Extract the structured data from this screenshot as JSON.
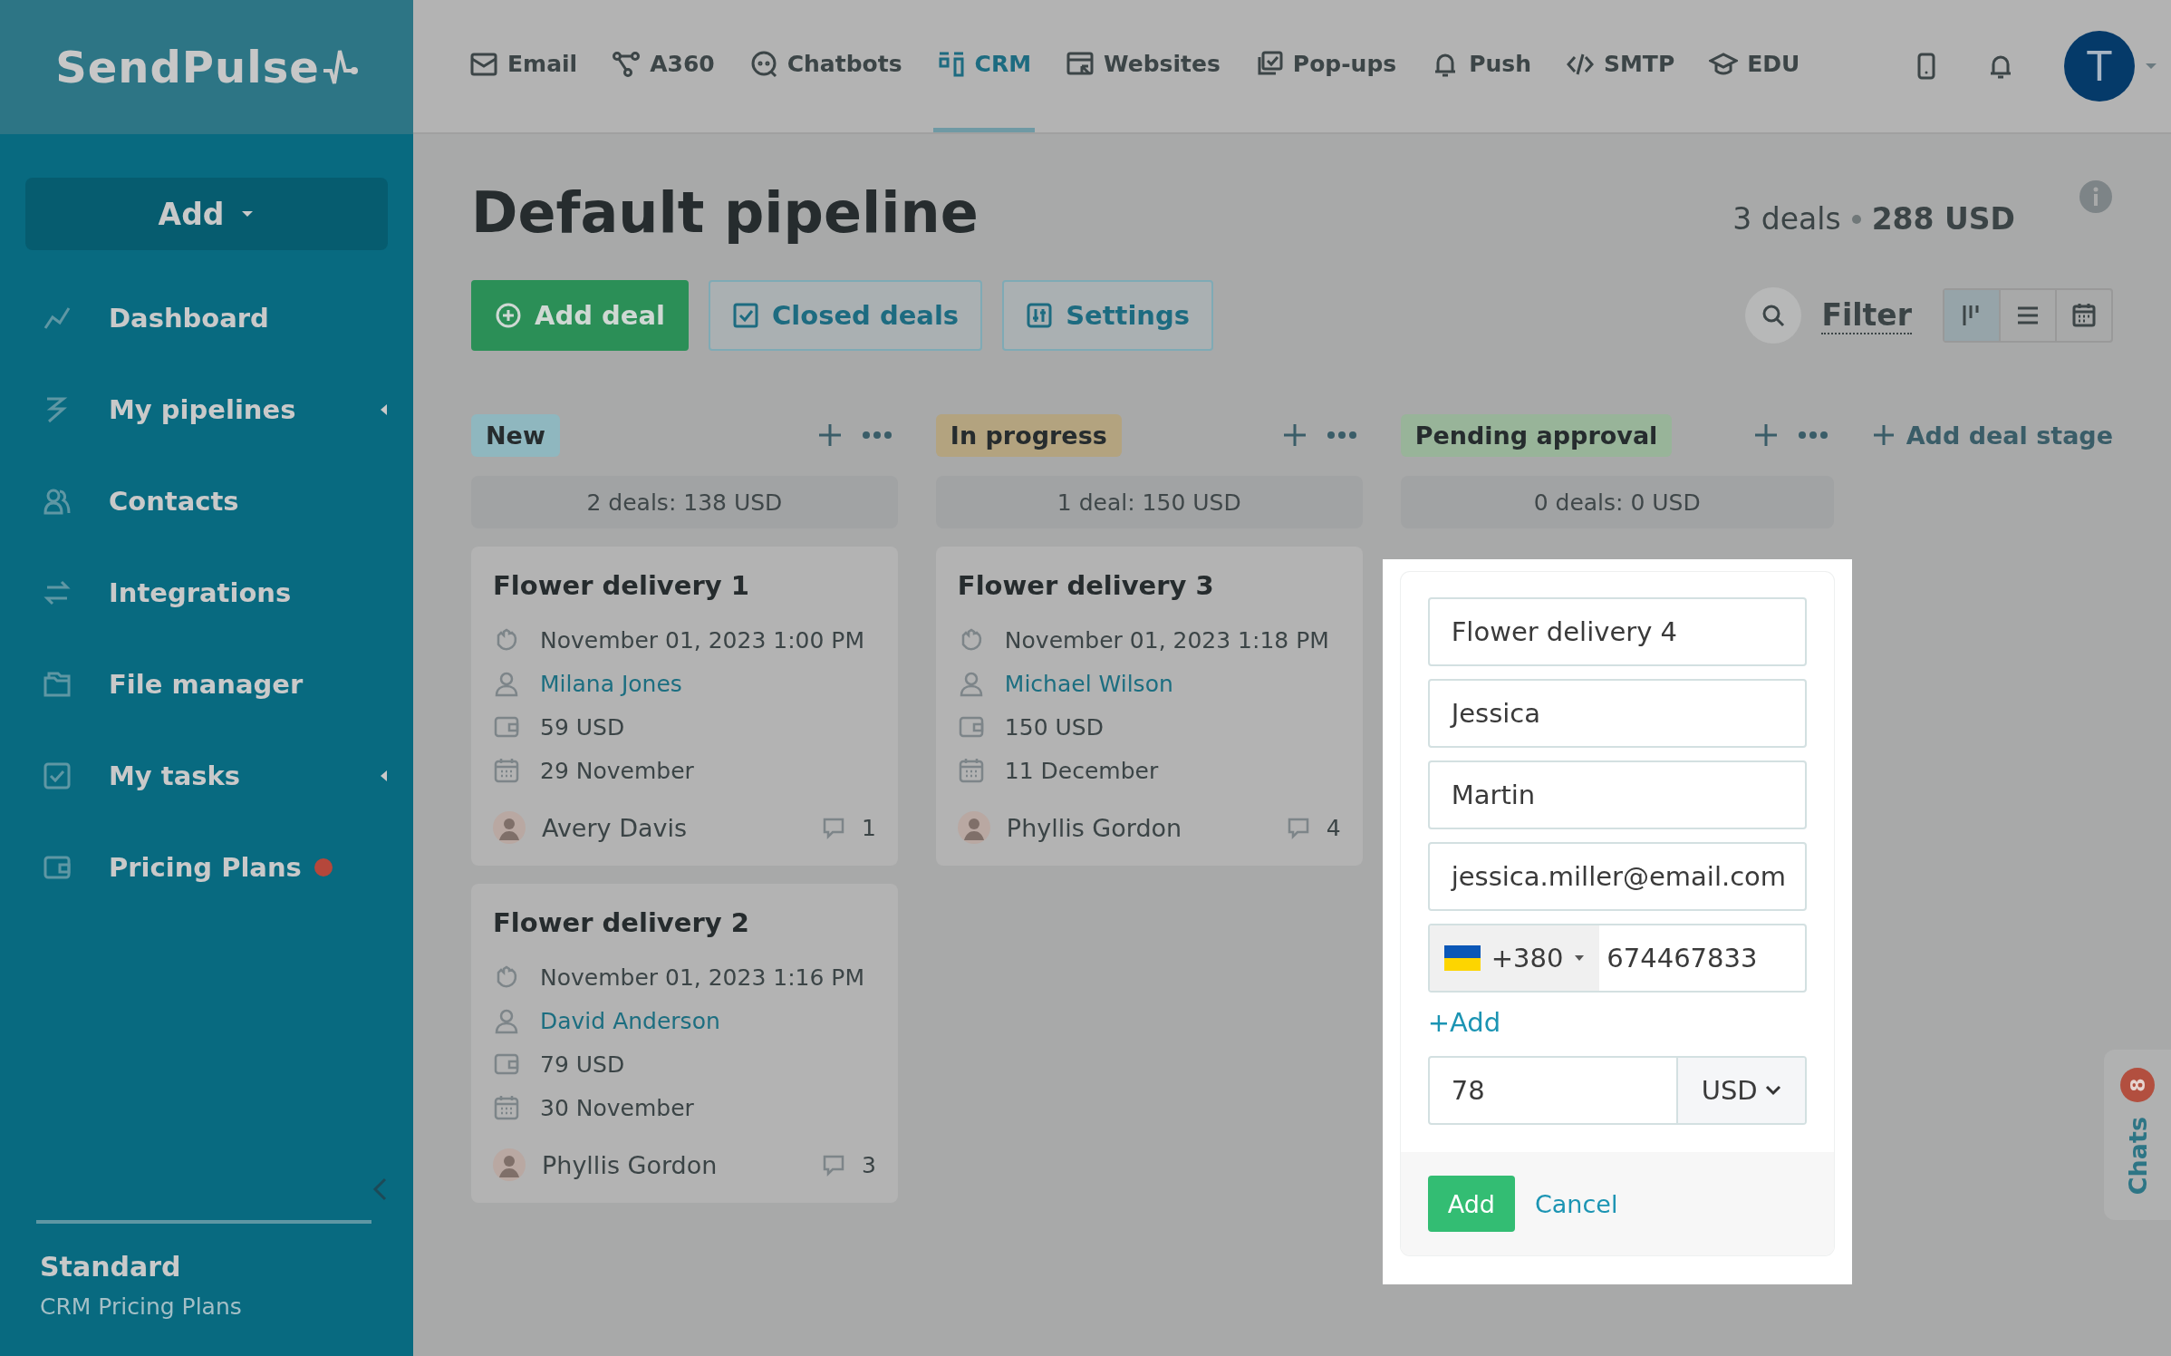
{
  "logo": "SendPulse",
  "nav": [
    {
      "label": "Email",
      "selected": false
    },
    {
      "label": "A360",
      "selected": false
    },
    {
      "label": "Chatbots",
      "selected": false
    },
    {
      "label": "CRM",
      "selected": true
    },
    {
      "label": "Websites",
      "selected": false
    },
    {
      "label": "Pop-ups",
      "selected": false
    },
    {
      "label": "Push",
      "selected": false
    },
    {
      "label": "SMTP",
      "selected": false
    },
    {
      "label": "EDU",
      "selected": false
    }
  ],
  "user": {
    "initial": "T"
  },
  "sidebar": {
    "add_button": "Add",
    "items": [
      {
        "label": "Dashboard",
        "expandable": false,
        "notification": false
      },
      {
        "label": "My pipelines",
        "expandable": true,
        "notification": false
      },
      {
        "label": "Contacts",
        "expandable": false,
        "notification": false
      },
      {
        "label": "Integrations",
        "expandable": false,
        "notification": false
      },
      {
        "label": "File manager",
        "expandable": false,
        "notification": false
      },
      {
        "label": "My tasks",
        "expandable": true,
        "notification": false
      },
      {
        "label": "Pricing Plans",
        "expandable": false,
        "notification": true
      }
    ],
    "plan": "Standard",
    "plan_note": "CRM Pricing Plans"
  },
  "page": {
    "title": "Default pipeline",
    "deals_count": "3 deals",
    "deals_total": "288 USD",
    "buttons": [
      {
        "label": "Add deal",
        "kind": "primary"
      },
      {
        "label": "Closed deals",
        "kind": "check"
      },
      {
        "label": "Settings",
        "kind": "settings"
      }
    ],
    "filter": "Filter",
    "views": [
      {
        "selected": true
      },
      {
        "selected": false
      },
      {
        "selected": false
      }
    ]
  },
  "stages": [
    {
      "name": "New",
      "color": "#8fb7bf",
      "summary": "2 deals: 138 USD",
      "deals": [
        {
          "title": "Flower delivery 1",
          "created": "November 01, 2023 1:00 PM",
          "contact": "Milana Jones",
          "amount": "59 USD",
          "due": "29 November",
          "owner": "Avery Davis",
          "comments": "1"
        },
        {
          "title": "Flower delivery 2",
          "created": "November 01, 2023 1:16 PM",
          "contact": "David Anderson",
          "amount": "79 USD",
          "due": "30 November",
          "owner": "Phyllis Gordon",
          "comments": "3"
        }
      ]
    },
    {
      "name": "In progress",
      "color": "#b3a37f",
      "summary": "1 deal: 150 USD",
      "deals": [
        {
          "title": "Flower delivery 3",
          "created": "November 01, 2023 1:18 PM",
          "contact": "Michael Wilson",
          "amount": "150 USD",
          "due": "11 December",
          "owner": "Phyllis Gordon",
          "comments": "4"
        }
      ]
    },
    {
      "name": "Pending approval",
      "color": "#98b499",
      "summary": "0 deals: 0 USD"
    }
  ],
  "add_stage": "Add deal stage",
  "form": {
    "name": "Flower delivery 4",
    "first_name": "Jessica",
    "last_name": "Martin",
    "email": "jessica.miller@email.com",
    "phone_code": "+380",
    "phone": "674467833",
    "add_link": "+Add",
    "amount": "78",
    "currency": "USD",
    "submit": "Add",
    "cancel": "Cancel"
  },
  "chats": {
    "label": "Chats",
    "count": "8"
  }
}
